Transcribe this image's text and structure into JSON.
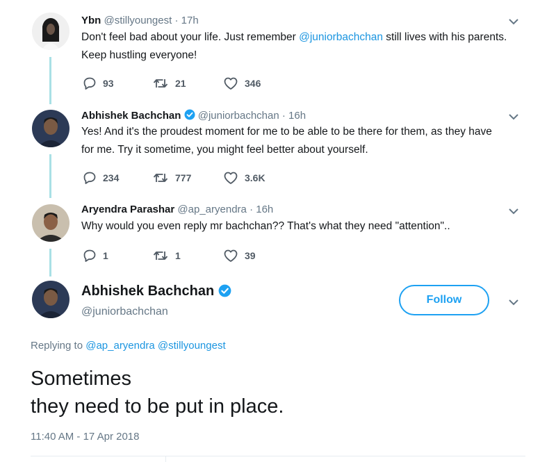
{
  "thread": [
    {
      "name": "Ybn",
      "handle": "@stillyoungest",
      "time": "17h",
      "text_before": "Don't feel bad about your life. Just remember ",
      "mention": "@juniorbachchan",
      "text_after": " still lives with his parents. Keep hustling everyone!",
      "replies": "93",
      "retweets": "21",
      "likes": "346"
    },
    {
      "name": "Abhishek Bachchan",
      "handle": "@juniorbachchan",
      "time": "16h",
      "text": "Yes! And it's the proudest moment for me to be able to be there for them, as they have for me. Try it sometime, you might feel better about yourself.",
      "replies": "234",
      "retweets": "777",
      "likes": "3.6K"
    },
    {
      "name": "Aryendra Parashar",
      "handle": "@ap_aryendra",
      "time": "16h",
      "text": "Why would you even reply mr bachchan?? That's what they need \"attention\"..",
      "replies": "1",
      "retweets": "1",
      "likes": "39"
    }
  ],
  "main": {
    "name": "Abhishek Bachchan",
    "handle": "@juniorbachchan",
    "follow_label": "Follow",
    "replying_to_label": "Replying to",
    "replying_to_1": "@ap_aryendra",
    "replying_to_2": "@stillyoungest",
    "text_line1": "Sometimes",
    "text_line2": "they need to be put in place.",
    "timestamp": "11:40 AM - 17 Apr 2018"
  },
  "separator": "·",
  "colors": {
    "accent": "#1da1f2",
    "mention": "#1b95e0",
    "thread_line": "#a9e0e5",
    "muted": "#657786"
  },
  "icons": [
    "reply-icon",
    "retweet-icon",
    "like-icon",
    "chevron-down-icon",
    "verified-badge-icon"
  ]
}
